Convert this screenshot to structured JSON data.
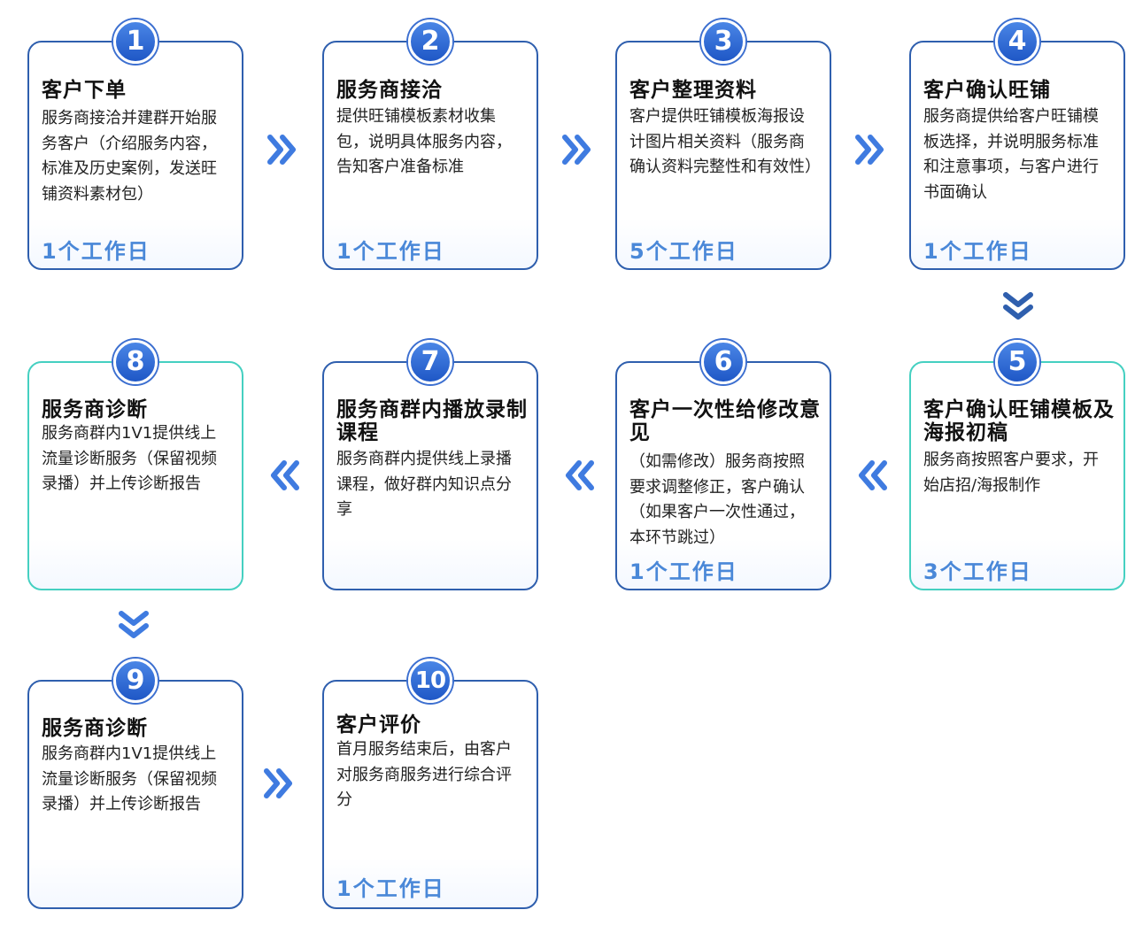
{
  "steps": [
    {
      "num": "1",
      "title": "客户下单",
      "desc": "服务商接洽并建群开始服务客户（介绍服务内容，标准及历史案例，发送旺铺资料素材包）",
      "days": "1个工作日"
    },
    {
      "num": "2",
      "title": "服务商接洽",
      "desc": "提供旺铺模板素材收集包，说明具体服务内容，告知客户准备标准",
      "days": "1个工作日"
    },
    {
      "num": "3",
      "title": "客户整理资料",
      "desc": "客户提供旺铺模板海报设计图片相关资料（服务商确认资料完整性和有效性）",
      "days": "5个工作日"
    },
    {
      "num": "4",
      "title": "客户确认旺铺",
      "desc": "服务商提供给客户旺铺模板选择，并说明服务标准和注意事项，与客户进行书面确认",
      "days": "1个工作日"
    },
    {
      "num": "5",
      "title": "客户确认旺铺模板及海报初稿",
      "desc": "服务商按照客户要求，开始店招/海报制作",
      "days": "3个工作日"
    },
    {
      "num": "6",
      "title": "客户一次性给修改意见",
      "desc": "（如需修改）服务商按照要求调整修正，客户确认（如果客户一次性通过，本环节跳过）",
      "days": "1个工作日"
    },
    {
      "num": "7",
      "title": "服务商群内播放录制课程",
      "desc": "服务商群内提供线上录播课程，做好群内知识点分享"
    },
    {
      "num": "8",
      "title": "服务商诊断",
      "desc": "服务商群内1V1提供线上流量诊断服务（保留视频录播）并上传诊断报告"
    },
    {
      "num": "9",
      "title": "服务商诊断",
      "desc": "服务商群内1V1提供线上流量诊断服务（保留视频录播）并上传诊断报告"
    },
    {
      "num": "10",
      "title": "客户评价",
      "desc": "首月服务结束后，由客户对服务商服务进行综合评分",
      "days": "1个工作日"
    }
  ],
  "colors": {
    "border": "#2f5fae",
    "border_teal": "#45d0c1",
    "badge": "#2a62cf",
    "days": "#4a88d8",
    "arrow": "#3f7be0"
  },
  "icons": {
    "right_arrow": "double-chevron-right-icon",
    "left_arrow": "double-chevron-left-icon",
    "down_arrow": "double-chevron-down-icon"
  }
}
